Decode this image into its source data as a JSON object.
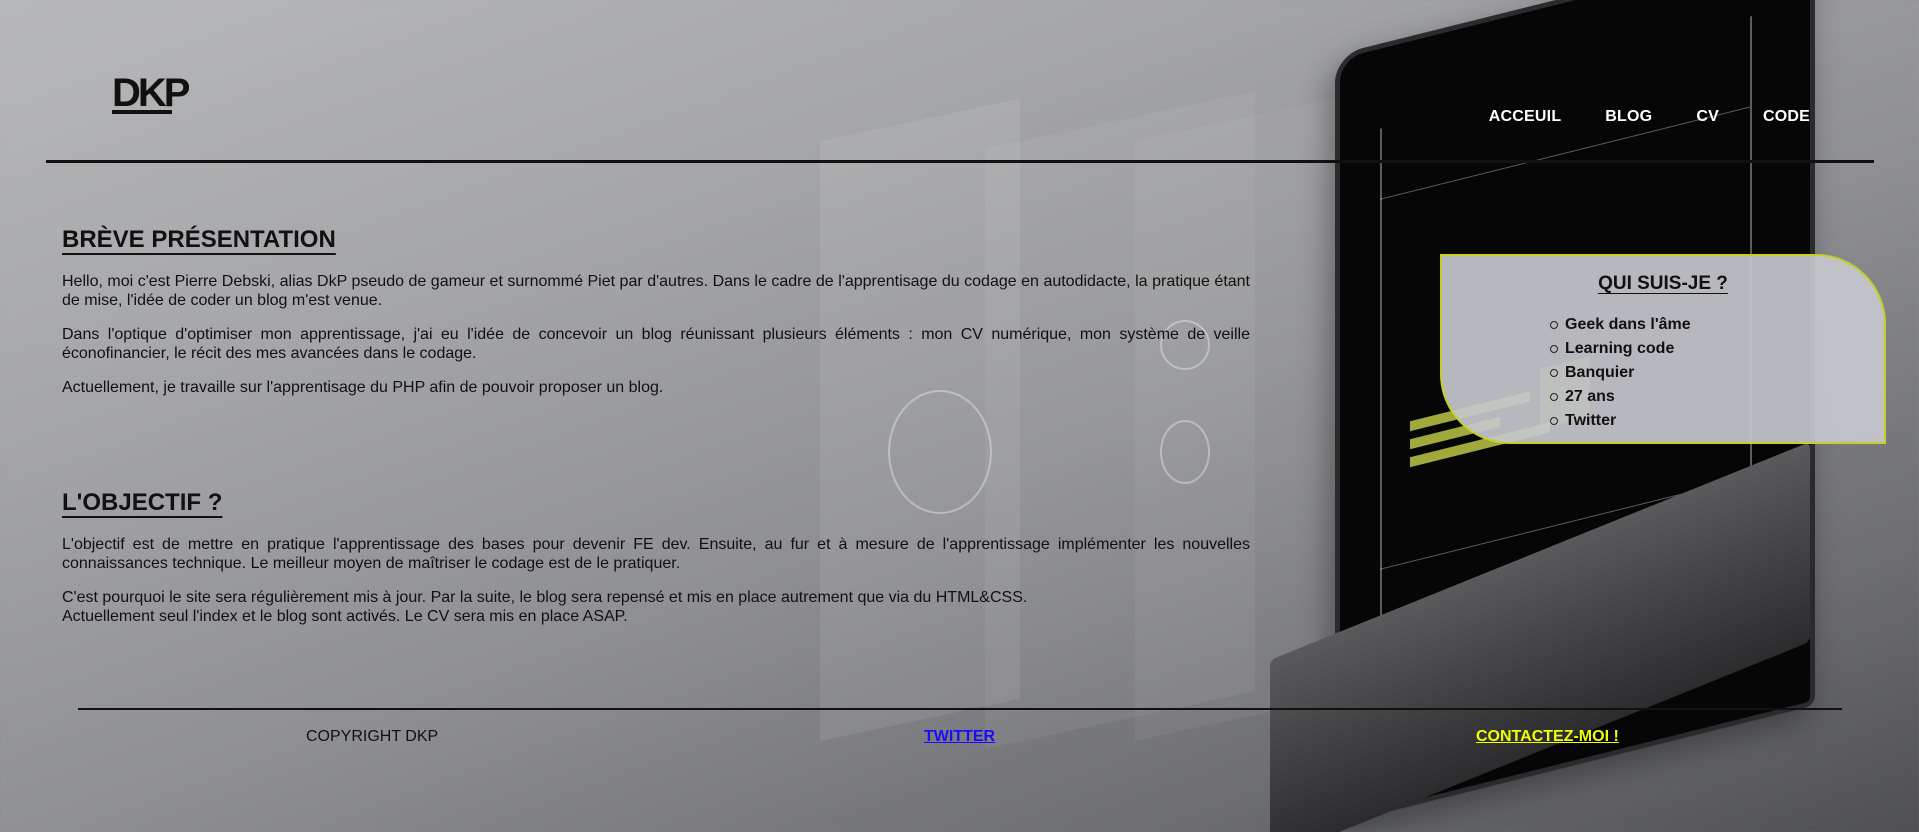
{
  "header": {
    "logo_text": "DKP",
    "nav": [
      {
        "label": "ACCEUIL"
      },
      {
        "label": "BLOG"
      },
      {
        "label": "CV"
      },
      {
        "label": "CODE"
      }
    ]
  },
  "presentation": {
    "title": "BRÈVE PRÉSENTATION",
    "paragraphs": [
      "Hello, moi c'est Pierre Debski, alias DkP pseudo de gameur et surnommé Piet par d'autres. Dans le cadre de l'apprentisage du codage en autodidacte, la pratique étant de mise, l'idée de coder un blog m'est venue.",
      "Dans l'optique d'optimiser mon apprentissage, j'ai eu l'idée de concevoir un blog réunissant plusieurs éléments : mon CV numérique, mon système de veille éconofinancier, le récit des mes avancées dans le codage.",
      "Actuellement, je travaille sur l'apprentisage du PHP afin de pouvoir proposer un blog."
    ]
  },
  "objective": {
    "title": "L'OBJECTIF ?",
    "paragraphs": [
      "L'objectif est de mettre en pratique l'apprentissage des bases pour devenir FE dev. Ensuite, au fur et à mesure de l'apprentissage implémenter les nouvelles connaissances technique. Le meilleur moyen de maîtriser le codage est de le pratiquer.",
      "C'est pourquoi le site sera régulièrement mis à jour. Par la suite, le blog sera repensé et mis en place autrement que via du HTML&CSS.",
      "Actuellement seul l'index et le blog sont activés. Le CV sera mis en place ASAP."
    ]
  },
  "card": {
    "title": "QUI SUIS-JE ?",
    "items": [
      "Geek dans l'âme",
      "Learning code",
      "Banquier",
      "27 ans",
      "Twitter"
    ]
  },
  "footer": {
    "copyright": "COPYRIGHT DKP",
    "twitter": "TWITTER",
    "contact": "CONTACTEZ-MOI !"
  },
  "colors": {
    "accent_yellow": "#c7cf24",
    "link_blue": "#1a0dff",
    "contact_yellow": "#f2ff00"
  }
}
